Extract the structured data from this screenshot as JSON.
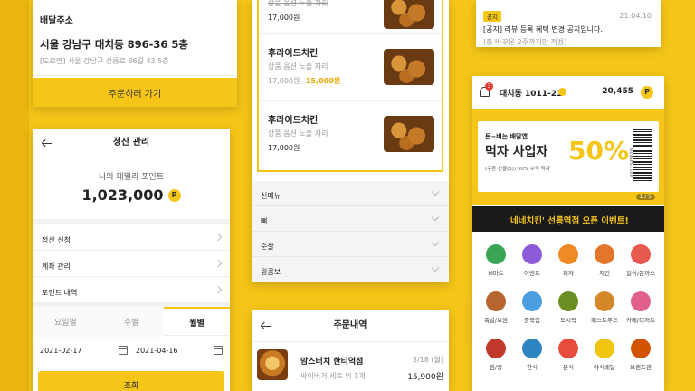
{
  "theme": {
    "accent": "#f5c518",
    "price_sale": "#f0a500"
  },
  "delivery": {
    "heading": "배달주소",
    "address": "서울 강남구 대치동 896-36 5층",
    "road_address": "[도로명] 서울 강남구 선릉로 86길 42 5층",
    "order_button": "주문하러 가기"
  },
  "settlement": {
    "title": "정산 관리",
    "points_label": "나의 패밀리 포인트",
    "points_value": "1,023,000",
    "points_badge": "P",
    "menu": [
      "정산 신청",
      "계좌 관리",
      "포인트 내역"
    ],
    "tabs": [
      "요일별",
      "주별",
      "월별"
    ],
    "active_tab": "월별",
    "date_from": "2021-02-17",
    "date_to": "2021-04-16",
    "search_button": "조회"
  },
  "menu_list": {
    "items": [
      {
        "option": "상품 옵션 노출 자리",
        "price": "17,000원",
        "name": ""
      },
      {
        "name": "후라이드치킨",
        "option": "상품 옵션 노출 자리",
        "original_price": "17,000원",
        "sale_price": "15,000원"
      },
      {
        "name": "후라이드치킨",
        "option": "상품 옵션 노출 자리",
        "price": "17,000원"
      }
    ],
    "categories": [
      "신메뉴",
      "뼈",
      "순살",
      "윙콤보"
    ]
  },
  "orders": {
    "title": "주문내역",
    "store": "맘스터치 한티역점",
    "date": "3/18 (월)",
    "summary": "싸이버거 세트 외 1개",
    "price": "15,900원"
  },
  "notice": {
    "tag": "공지",
    "date": "21.04.10",
    "text": "[공지] 리뷰 등록 혜택 변경 공지입니다.",
    "sub": "(총 바꾸온 2주까지만 적용)"
  },
  "home": {
    "location": "대치동 1011-21",
    "notification_count": "3",
    "points": "20,455",
    "points_badge": "P",
    "coupon": {
      "brand_line": "돈~버는 배달앱",
      "headline": "먹자 사업자",
      "sub": "(쿠폰 선물(5)) 50% 수익 적자",
      "percent": "50%",
      "serial": "0012345678"
    },
    "page_indicator": "1 / 5",
    "event_banner": "'네네치킨' 선릉역점 오픈 이벤트!",
    "categories": [
      {
        "label": "M마트",
        "icon": "basket-icon",
        "color": "#3aa655"
      },
      {
        "label": "이벤트",
        "icon": "gift-icon",
        "color": "#8e5bd8"
      },
      {
        "label": "피자",
        "icon": "pizza-icon",
        "color": "#f08a24"
      },
      {
        "label": "치킨",
        "icon": "chicken-icon",
        "color": "#e3762a"
      },
      {
        "label": "일식/돈까스",
        "icon": "sushi-icon",
        "color": "#e85a4f"
      },
      {
        "label": "족발/보쌈",
        "icon": "pork-icon",
        "color": "#b5652d"
      },
      {
        "label": "중국집",
        "icon": "noodle-icon",
        "color": "#4a9ee0"
      },
      {
        "label": "도시락",
        "icon": "lunchbox-icon",
        "color": "#6b8e23"
      },
      {
        "label": "패스트푸드",
        "icon": "burger-icon",
        "color": "#d4882a"
      },
      {
        "label": "카페/디저트",
        "icon": "cake-icon",
        "color": "#e0608a"
      },
      {
        "label": "찜/탕",
        "icon": "stew-icon",
        "color": "#c0392b"
      },
      {
        "label": "한식",
        "icon": "rice-icon",
        "color": "#2e86c1"
      },
      {
        "label": "분식",
        "icon": "tteokbokki-icon",
        "color": "#e74c3c"
      },
      {
        "label": "야식배달",
        "icon": "moon-icon",
        "color": "#f1c40f"
      },
      {
        "label": "브랜드관",
        "icon": "brand-icon",
        "color": "#d35400"
      }
    ]
  }
}
